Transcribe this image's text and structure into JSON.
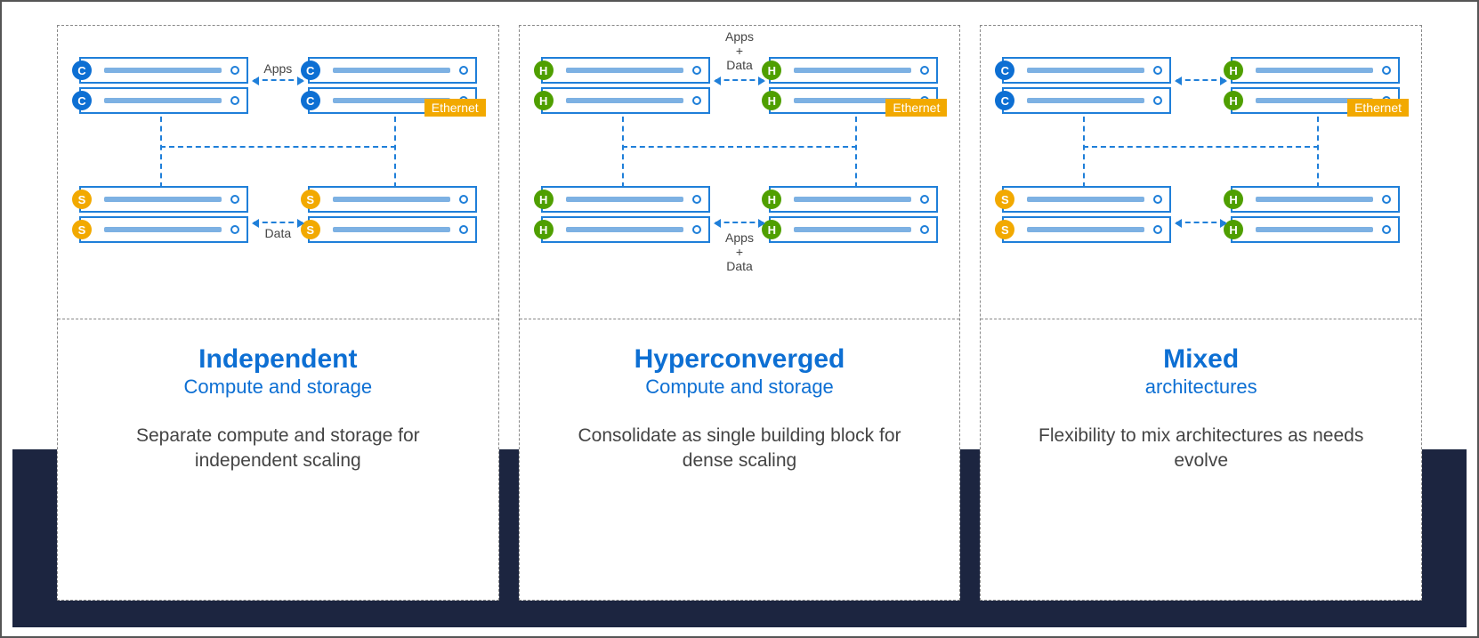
{
  "ethernet_label": "Ethernet",
  "panels": [
    {
      "title": "Independent",
      "subtitle": "Compute and storage",
      "desc": "Separate compute and storage for independent scaling",
      "top_label": "Apps",
      "bottom_label": "Data",
      "nodes": {
        "tl": "C",
        "tr": "C",
        "bl": "S",
        "br": "S"
      }
    },
    {
      "title": "Hyperconverged",
      "subtitle": "Compute and storage",
      "desc": "Consolidate as single building block for dense scaling",
      "top_label": "Apps\n+\nData",
      "bottom_label": "Apps\n+\nData",
      "nodes": {
        "tl": "H",
        "tr": "H",
        "bl": "H",
        "br": "H"
      }
    },
    {
      "title": "Mixed",
      "subtitle": "architectures",
      "desc": "Flexibility to mix architectures as needs evolve",
      "top_label": "",
      "bottom_label": "",
      "nodes": {
        "tl": "C",
        "tr": "H",
        "bl": "S",
        "br": "H"
      }
    }
  ]
}
